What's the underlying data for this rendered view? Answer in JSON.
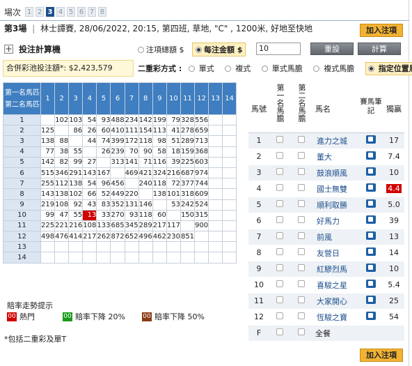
{
  "races": {
    "label": "場次",
    "items": [
      "1",
      "2",
      "3",
      "4",
      "5",
      "6",
      "7",
      "8"
    ],
    "active": "3"
  },
  "race_info": {
    "race": "第3場",
    "details": "林士譚賽, 28/06/2022, 20:15, 第四班, 草地, \"C\" , 1200米, 好地至快地"
  },
  "add_bet_label": "加入注項",
  "calculator": {
    "title": "投注計算機",
    "opt_total": "注項總額 $",
    "opt_each": "每注金額 $",
    "amount": "10",
    "reset": "重設",
    "calc": "計算"
  },
  "pool": {
    "text": "合併彩池投注額*: $2,423,579"
  },
  "mode": {
    "label": "二重彩方式 :",
    "options": [
      "單式",
      "複式",
      "單式馬膽",
      "複式馬膽",
      "指定位置馬膽"
    ],
    "selected": "指定位置馬膽"
  },
  "grid": {
    "corner_top": "第一名馬匹",
    "corner_bottom": "第二名馬匹",
    "cols": [
      "1",
      "2",
      "3",
      "4",
      "5",
      "6",
      "7",
      "8",
      "9",
      "10",
      "11",
      "12",
      "13",
      "14"
    ],
    "rows": [
      {
        "n": "1",
        "v": [
          "",
          "102",
          "103",
          "54",
          "93",
          "488",
          "234",
          "142",
          "199",
          "79",
          "328",
          "556",
          "",
          ""
        ]
      },
      {
        "n": "2",
        "v": [
          "125",
          "",
          "86",
          "26",
          "60",
          "410",
          "111",
          "154",
          "113",
          "41",
          "278",
          "659",
          "",
          ""
        ]
      },
      {
        "n": "3",
        "v": [
          "138",
          "88",
          "",
          "44",
          "74",
          "399",
          "172",
          "118",
          "98",
          "51",
          "289",
          "713",
          "",
          ""
        ]
      },
      {
        "n": "4",
        "v": [
          "77",
          "38",
          "55",
          "",
          "26",
          "239",
          "70",
          "90",
          "58",
          "18",
          "159",
          "368",
          "",
          ""
        ]
      },
      {
        "n": "5",
        "v": [
          "142",
          "82",
          "99",
          "27",
          "",
          "313",
          "141",
          "71",
          "116",
          "39",
          "225",
          "603",
          "",
          ""
        ]
      },
      {
        "n": "6",
        "v": [
          "515",
          "346",
          "291",
          "143",
          "167",
          "",
          "469",
          "421",
          "324",
          "216",
          "687",
          "974",
          "",
          ""
        ]
      },
      {
        "n": "7",
        "v": [
          "255",
          "112",
          "138",
          "54",
          "96",
          "456",
          "",
          "240",
          "118",
          "72",
          "377",
          "744",
          "",
          ""
        ]
      },
      {
        "n": "8",
        "v": [
          "143",
          "138",
          "102",
          "66",
          "52",
          "449",
          "220",
          "",
          "138",
          "101",
          "318",
          "609",
          "",
          ""
        ]
      },
      {
        "n": "9",
        "v": [
          "219",
          "108",
          "92",
          "43",
          "83",
          "352",
          "131",
          "146",
          "",
          "53",
          "242",
          "524",
          "",
          ""
        ]
      },
      {
        "n": "10",
        "v": [
          "99",
          "47",
          "55",
          "13",
          "33",
          "270",
          "93",
          "118",
          "60",
          "",
          "150",
          "315",
          "",
          ""
        ]
      },
      {
        "n": "11",
        "v": [
          "225",
          "221",
          "216",
          "108",
          "133",
          "685",
          "345",
          "289",
          "217",
          "117",
          "",
          "900",
          "",
          ""
        ]
      },
      {
        "n": "12",
        "v": [
          "498",
          "476",
          "414",
          "217",
          "262",
          "872",
          "652",
          "496",
          "462",
          "230",
          "851",
          "",
          "",
          ""
        ]
      },
      {
        "n": "13",
        "v": [
          "",
          "",
          "",
          "",
          "",
          "",
          "",
          "",
          "",
          "",
          "",
          "",
          "",
          ""
        ]
      },
      {
        "n": "14",
        "v": [
          "",
          "",
          "",
          "",
          "",
          "",
          "",
          "",
          "",
          "",
          "",
          "",
          "",
          ""
        ]
      }
    ],
    "hot_cell": {
      "row": "10",
      "col": "4"
    }
  },
  "legend": {
    "title": "賠率走勢提示",
    "items": [
      {
        "code": "00",
        "label": "熱門",
        "color": "#d10000"
      },
      {
        "code": "00",
        "label": "賠率下降 20%",
        "color": "#1a9b1a"
      },
      {
        "code": "00",
        "label": "賠率下降 50%",
        "color": "#8a3b12"
      }
    ],
    "note": "*包括二重彩及單T"
  },
  "runners": {
    "headers": {
      "no": "馬號",
      "first": "第一名馬膽",
      "second": "第二名馬膽",
      "name": "馬名",
      "notes": "賽馬筆記",
      "win": "獨贏"
    },
    "rows": [
      {
        "no": "1",
        "name": "進力之城",
        "win": "17"
      },
      {
        "no": "2",
        "name": "董大",
        "win": "7.4"
      },
      {
        "no": "3",
        "name": "鼓浪順風",
        "win": "10"
      },
      {
        "no": "4",
        "name": "國士無雙",
        "win": "4.4",
        "hot": true
      },
      {
        "no": "5",
        "name": "順利取勝",
        "win": "5.0"
      },
      {
        "no": "6",
        "name": "好馬力",
        "win": "39"
      },
      {
        "no": "7",
        "name": "前風",
        "win": "13"
      },
      {
        "no": "8",
        "name": "友營日",
        "win": "14"
      },
      {
        "no": "9",
        "name": "紅驂烈馬",
        "win": "10"
      },
      {
        "no": "10",
        "name": "喜駿之星",
        "win": "5.4"
      },
      {
        "no": "11",
        "name": "大家開心",
        "win": "25"
      },
      {
        "no": "12",
        "name": "恆駿之寶",
        "win": "54"
      }
    ],
    "field": {
      "no": "F",
      "label": "全餐"
    }
  },
  "colors": {
    "header_blue": "#3f7ec0",
    "accent_gold": "#f2b233",
    "hot_red": "#d10000"
  }
}
